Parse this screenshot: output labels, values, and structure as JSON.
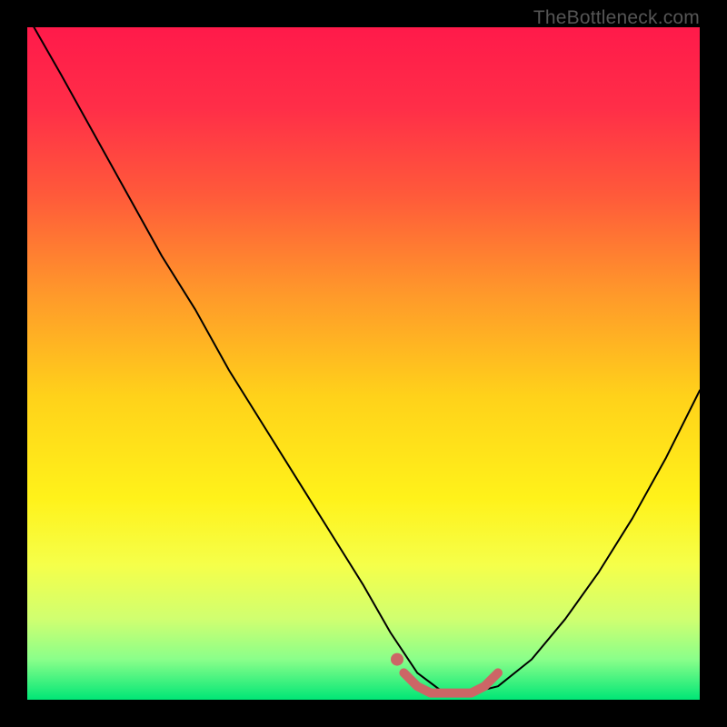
{
  "watermark": "TheBottleneck.com",
  "chart_data": {
    "type": "line",
    "title": "",
    "xlabel": "",
    "ylabel": "",
    "xlim": [
      0,
      100
    ],
    "ylim": [
      0,
      100
    ],
    "background_gradient": {
      "stops": [
        {
          "offset": 0,
          "color": "#ff1a4a"
        },
        {
          "offset": 12,
          "color": "#ff2e48"
        },
        {
          "offset": 25,
          "color": "#ff5a3a"
        },
        {
          "offset": 40,
          "color": "#ff9a2a"
        },
        {
          "offset": 55,
          "color": "#ffd21a"
        },
        {
          "offset": 70,
          "color": "#fff21a"
        },
        {
          "offset": 80,
          "color": "#f5ff4a"
        },
        {
          "offset": 88,
          "color": "#d0ff70"
        },
        {
          "offset": 94,
          "color": "#8aff8a"
        },
        {
          "offset": 100,
          "color": "#00e676"
        }
      ]
    },
    "series": [
      {
        "name": "bottleneck-curve",
        "color": "#000000",
        "width": 2,
        "x": [
          1,
          5,
          10,
          15,
          20,
          25,
          30,
          35,
          40,
          45,
          50,
          54,
          58,
          62,
          66,
          70,
          75,
          80,
          85,
          90,
          95,
          100
        ],
        "y": [
          100,
          93,
          84,
          75,
          66,
          58,
          49,
          41,
          33,
          25,
          17,
          10,
          4,
          1,
          1,
          2,
          6,
          12,
          19,
          27,
          36,
          46
        ]
      },
      {
        "name": "highlight-optimal",
        "color": "#cc6666",
        "width": 10,
        "x": [
          56,
          58,
          60,
          62,
          64,
          66,
          68,
          70
        ],
        "y": [
          4,
          2,
          1,
          1,
          1,
          1,
          2,
          4
        ]
      },
      {
        "name": "highlight-dot",
        "color": "#cc6666",
        "type": "point",
        "x": 55,
        "y": 6,
        "r": 7
      }
    ]
  }
}
